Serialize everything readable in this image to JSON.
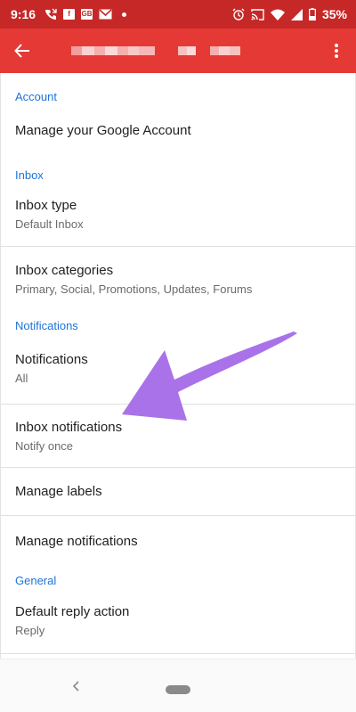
{
  "status_bar": {
    "time": "9:16",
    "notif_icons": [
      "phone-missed-icon",
      "facebook-icon",
      "news-icon",
      "gmail-icon"
    ],
    "notif_box_labels": [
      "f",
      "GB"
    ],
    "battery": "35%"
  },
  "app_bar": {
    "back_icon": "arrow-left-icon",
    "more_icon": "more-vert-icon",
    "title_obscured": true
  },
  "sections": {
    "account": {
      "header": "Account",
      "manage_google_account": "Manage your Google Account"
    },
    "inbox": {
      "header": "Inbox",
      "inbox_type": {
        "title": "Inbox type",
        "value": "Default Inbox"
      },
      "inbox_categories": {
        "title": "Inbox categories",
        "value": "Primary, Social, Promotions, Updates, Forums"
      }
    },
    "notifications": {
      "header": "Notifications",
      "notifications": {
        "title": "Notifications",
        "value": "All"
      },
      "inbox_notifications": {
        "title": "Inbox notifications",
        "value": "Notify once"
      },
      "manage_labels": "Manage labels",
      "manage_notifications": "Manage notifications"
    },
    "general": {
      "header": "General",
      "default_reply_action": {
        "title": "Default reply action",
        "value": "Reply"
      }
    }
  },
  "colors": {
    "status_bar": "#c62828",
    "app_bar": "#e53935",
    "section_header": "#1e73d9",
    "annotation_arrow": "#a46ae8"
  }
}
